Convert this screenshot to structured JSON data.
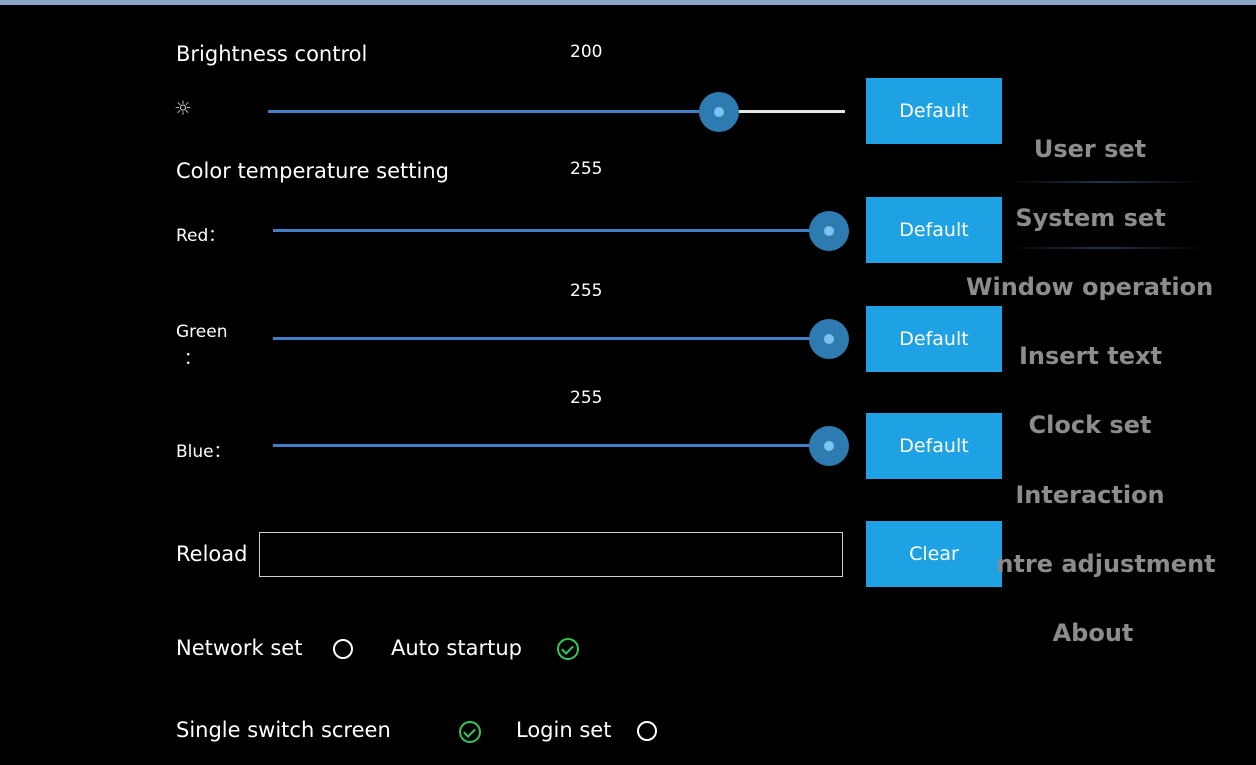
{
  "brightness": {
    "label": "Brightness control",
    "value": "200",
    "level_fraction": 0.787,
    "default_label": "Default"
  },
  "color_temp": {
    "label": "Color temperature setting",
    "red": {
      "label": "Red：",
      "value": "255",
      "default_label": "Default"
    },
    "green": {
      "label_line1": "Green",
      "label_line2": "：",
      "value": "255",
      "default_label": "Default"
    },
    "blue": {
      "label": "Blue：",
      "value": "255",
      "default_label": "Default"
    }
  },
  "reload": {
    "label": "Reload",
    "value": "",
    "clear_label": "Clear"
  },
  "options": {
    "network_set": {
      "label": "Network set",
      "checked": false
    },
    "auto_startup": {
      "label": "Auto startup",
      "checked": true
    },
    "single_switch_screen": {
      "label": "Single switch screen",
      "checked": true
    },
    "login_set": {
      "label": "Login set",
      "checked": false
    }
  },
  "menu": {
    "items": [
      {
        "label": "User set"
      },
      {
        "label": "System set"
      },
      {
        "label": "Window operation"
      },
      {
        "label": "Insert text"
      },
      {
        "label": "Clock set"
      },
      {
        "label": "Interaction"
      },
      {
        "label": "ntre adjustment"
      },
      {
        "label": "About"
      }
    ],
    "selected": "System set"
  },
  "colors": {
    "accent": "#1fa2e3",
    "track": "#3f7fc7",
    "check": "#34c75a",
    "menu_text": "#8c8c8c",
    "background": "#000000"
  }
}
